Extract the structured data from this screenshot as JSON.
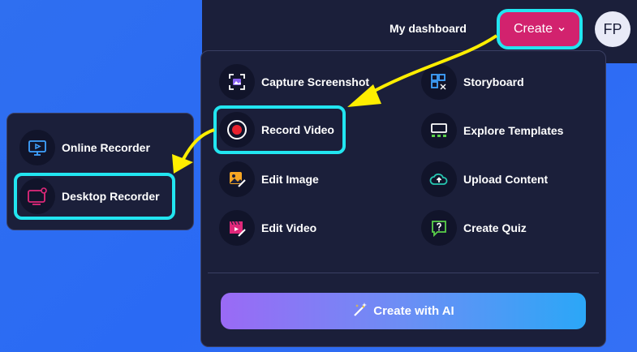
{
  "header": {
    "dashboard_label": "My dashboard",
    "create_label": "Create",
    "avatar_initials": "FP"
  },
  "menu": {
    "items": [
      {
        "label": "Capture Screenshot",
        "icon": "screenshot-icon"
      },
      {
        "label": "Storyboard",
        "icon": "storyboard-icon"
      },
      {
        "label": "Record Video",
        "icon": "record-icon"
      },
      {
        "label": "Explore Templates",
        "icon": "templates-icon"
      },
      {
        "label": "Edit Image",
        "icon": "image-edit-icon"
      },
      {
        "label": "Upload Content",
        "icon": "cloud-upload-icon"
      },
      {
        "label": "Edit Video",
        "icon": "video-edit-icon"
      },
      {
        "label": "Create Quiz",
        "icon": "quiz-icon"
      }
    ],
    "ai_label": "Create with AI"
  },
  "submenu": {
    "items": [
      {
        "label": "Online Recorder",
        "icon": "monitor-play-icon"
      },
      {
        "label": "Desktop Recorder",
        "icon": "desktop-record-icon"
      }
    ]
  },
  "colors": {
    "background": "#2f6ff0",
    "panel": "#1b1f3a",
    "create_button": "#d2226e",
    "highlight": "#22e5f0",
    "arrow": "#ffee00"
  }
}
